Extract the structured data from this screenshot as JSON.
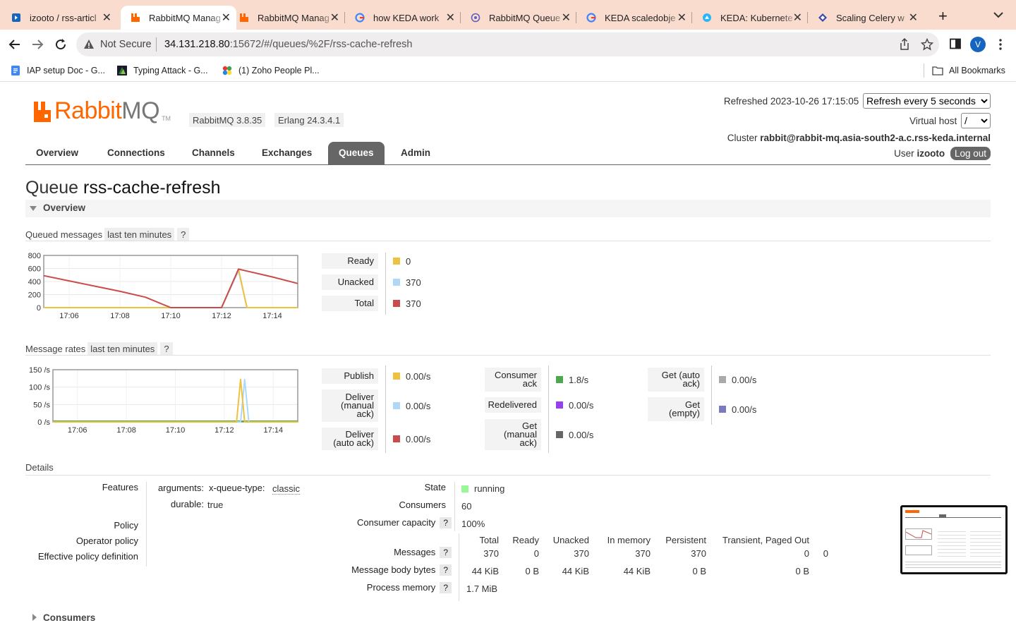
{
  "browser": {
    "tabs": [
      {
        "title": "izooto / rss-articl",
        "favicon": "wordpress-icon",
        "active": false
      },
      {
        "title": "RabbitMQ Manag",
        "favicon": "rabbitmq-icon",
        "active": true
      },
      {
        "title": "RabbitMQ Manag",
        "favicon": "rabbitmq-icon",
        "active": false
      },
      {
        "title": "how KEDA work",
        "favicon": "google-icon",
        "active": false
      },
      {
        "title": "RabbitMQ Queue",
        "favicon": "keda-icon",
        "active": false
      },
      {
        "title": "KEDA scaledobje",
        "favicon": "google-icon",
        "active": false
      },
      {
        "title": "KEDA: Kubernete",
        "favicon": "keda-blue-icon",
        "active": false
      },
      {
        "title": "Scaling Celery w",
        "favicon": "diamond-icon",
        "active": false
      }
    ],
    "security_label": "Not Secure",
    "url_host": "34.131.218.80",
    "url_rest": ":15672/#/queues/%2F/rss-cache-refresh",
    "avatar_letter": "V",
    "bookmarks": [
      {
        "label": "IAP setup Doc - G..."
      },
      {
        "label": "Typing Attack - G..."
      },
      {
        "label": "(1) Zoho People Pl..."
      }
    ],
    "all_bookmarks": "All Bookmarks"
  },
  "header": {
    "logo_brand": "Rabbit",
    "logo_suffix": "MQ",
    "logo_tm": "TM",
    "version": "RabbitMQ 3.8.35",
    "erlang": "Erlang 24.3.4.1",
    "refreshed_label": "Refreshed 2023-10-26 17:15:05",
    "refresh_option": "Refresh every 5 seconds",
    "vhost_label": "Virtual host",
    "vhost_value": "/",
    "cluster_label": "Cluster",
    "cluster_name": "rabbit@rabbit-mq.asia-south2-a.c.rss-keda.internal",
    "user_label": "User",
    "user_name": "izooto",
    "logout": "Log out"
  },
  "nav": {
    "overview": "Overview",
    "connections": "Connections",
    "channels": "Channels",
    "exchanges": "Exchanges",
    "queues": "Queues",
    "admin": "Admin"
  },
  "page": {
    "title_prefix": "Queue",
    "queue_name": "rss-cache-refresh",
    "overview_section": "Overview",
    "consumers_section": "Consumers"
  },
  "queued": {
    "heading": "Queued messages",
    "range": "last ten minutes",
    "help": "?",
    "stats": [
      {
        "label": "Ready",
        "value": "0",
        "color": "#edc240"
      },
      {
        "label": "Unacked",
        "value": "370",
        "color": "#afd8f8"
      },
      {
        "label": "Total",
        "value": "370",
        "color": "#cb4b4b"
      }
    ]
  },
  "rates": {
    "heading": "Message rates",
    "range": "last ten minutes",
    "help": "?",
    "col1": [
      {
        "label": "Publish",
        "value": "0.00/s",
        "color": "#edc240"
      },
      {
        "label": "Deliver (manual ack)",
        "value": "0.00/s",
        "color": "#afd8f8"
      },
      {
        "label": "Deliver (auto ack)",
        "value": "0.00/s",
        "color": "#cb4b4b"
      }
    ],
    "col2": [
      {
        "label": "Consumer ack",
        "value": "1.8/s",
        "color": "#4da74d"
      },
      {
        "label": "Redelivered",
        "value": "0.00/s",
        "color": "#9440ed"
      },
      {
        "label": "Get (manual ack)",
        "value": "0.00/s",
        "color": "#666666"
      }
    ],
    "col3": [
      {
        "label": "Get (auto ack)",
        "value": "0.00/s",
        "color": "#aaaaaa"
      },
      {
        "label": "Get (empty)",
        "value": "0.00/s",
        "color": "#7c79c3"
      }
    ]
  },
  "chart_data": [
    {
      "type": "line",
      "title": "",
      "x": [
        "17:05",
        "17:06",
        "17:07",
        "17:08",
        "17:09",
        "17:10",
        "17:11",
        "17:12",
        "17:12:40",
        "17:13",
        "17:14",
        "17:15"
      ],
      "xticks": [
        "17:06",
        "17:08",
        "17:10",
        "17:12",
        "17:14"
      ],
      "yticks": [
        "800",
        "600",
        "400",
        "200",
        "0"
      ],
      "ylim": [
        0,
        800
      ],
      "series": [
        {
          "name": "Total",
          "color": "#cb4b4b",
          "values": [
            490,
            410,
            330,
            250,
            160,
            0,
            0,
            0,
            590,
            560,
            470,
            370
          ]
        },
        {
          "name": "Ready",
          "color": "#edc240",
          "values": [
            0,
            0,
            0,
            0,
            0,
            0,
            0,
            0,
            590,
            0,
            0,
            0
          ]
        },
        {
          "name": "Unacked",
          "color": "#afd8f8",
          "values": [
            0,
            0,
            0,
            0,
            0,
            0,
            0,
            0,
            560,
            0,
            0,
            0
          ]
        }
      ]
    },
    {
      "type": "line",
      "title": "",
      "x": [
        "17:05",
        "17:12:30",
        "17:12:40",
        "17:12:50",
        "17:13",
        "17:15"
      ],
      "xticks": [
        "17:06",
        "17:08",
        "17:10",
        "17:12",
        "17:14"
      ],
      "yticks": [
        "150 /s",
        "100 /s",
        "50 /s",
        "0 /s"
      ],
      "ylim": [
        0,
        150
      ],
      "series": [
        {
          "name": "Publish",
          "color": "#edc240",
          "values": [
            0,
            0,
            122,
            0,
            0,
            0
          ]
        },
        {
          "name": "Deliver (manual ack)",
          "color": "#afd8f8",
          "values": [
            0,
            0,
            0,
            122,
            0,
            0
          ]
        },
        {
          "name": "Consumer ack",
          "color": "#4da74d",
          "values": [
            2,
            2,
            2,
            2,
            2,
            2
          ]
        }
      ]
    }
  ],
  "details": {
    "heading": "Details",
    "features_label": "Features",
    "arguments_label": "arguments:",
    "x_queue_type_key": "x-queue-type:",
    "x_queue_type_val": "classic",
    "durable_label": "durable:",
    "durable_val": "true",
    "policy_label": "Policy",
    "operator_policy_label": "Operator policy",
    "effective_policy_label": "Effective policy definition",
    "state_label": "State",
    "state_value": "running",
    "consumers_label": "Consumers",
    "consumers_value": "60",
    "capacity_label": "Consumer capacity",
    "capacity_value": "100%",
    "help": "?",
    "table_headers": [
      "Total",
      "Ready",
      "Unacked",
      "In memory",
      "Persistent",
      "Transient, Paged Out"
    ],
    "messages_label": "Messages",
    "messages_row": [
      "370",
      "0",
      "370",
      "370",
      "370",
      "0",
      "0"
    ],
    "body_bytes_label": "Message body bytes",
    "body_bytes_row": [
      "44 KiB",
      "0 B",
      "44 KiB",
      "44 KiB",
      "0 B",
      "0 B"
    ],
    "process_memory_label": "Process memory",
    "process_memory_value": "1.7 MiB"
  }
}
